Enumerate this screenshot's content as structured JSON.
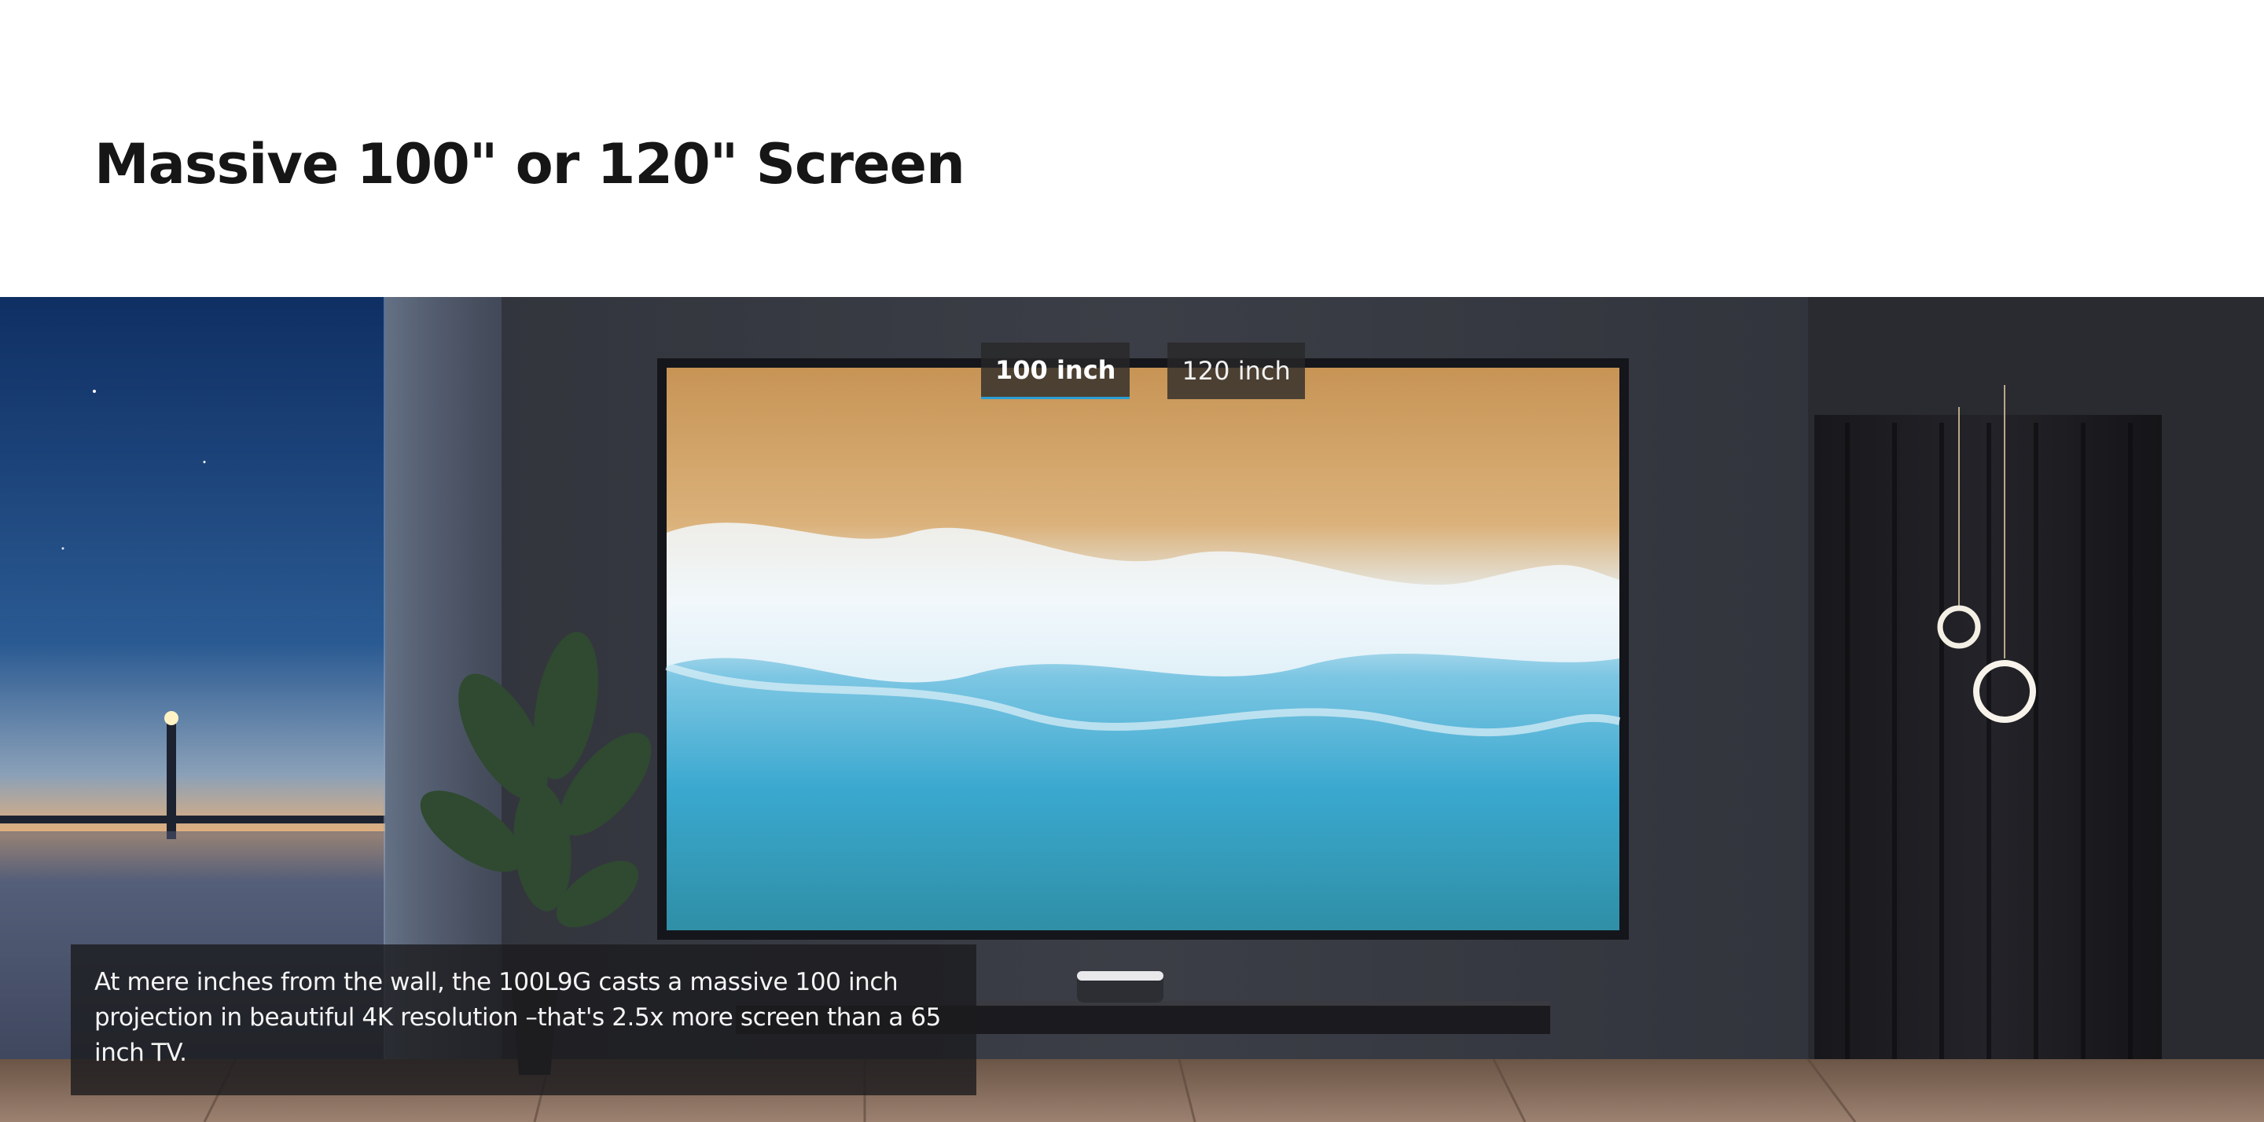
{
  "section": {
    "title": "Massive 100\" or 120\" Screen"
  },
  "size_tabs": {
    "items": [
      {
        "label": "100 inch",
        "active": true
      },
      {
        "label": "120 inch",
        "active": false
      }
    ]
  },
  "caption": {
    "text": "At mere inches from the wall, the 100L9G casts a massive 100 inch projection in beautiful 4K resolution –that's 2.5x more screen than a 65 inch TV."
  },
  "colors": {
    "tab_active_underline": "#2a9fd6",
    "wall": "#35373f",
    "title_text": "#161616"
  }
}
